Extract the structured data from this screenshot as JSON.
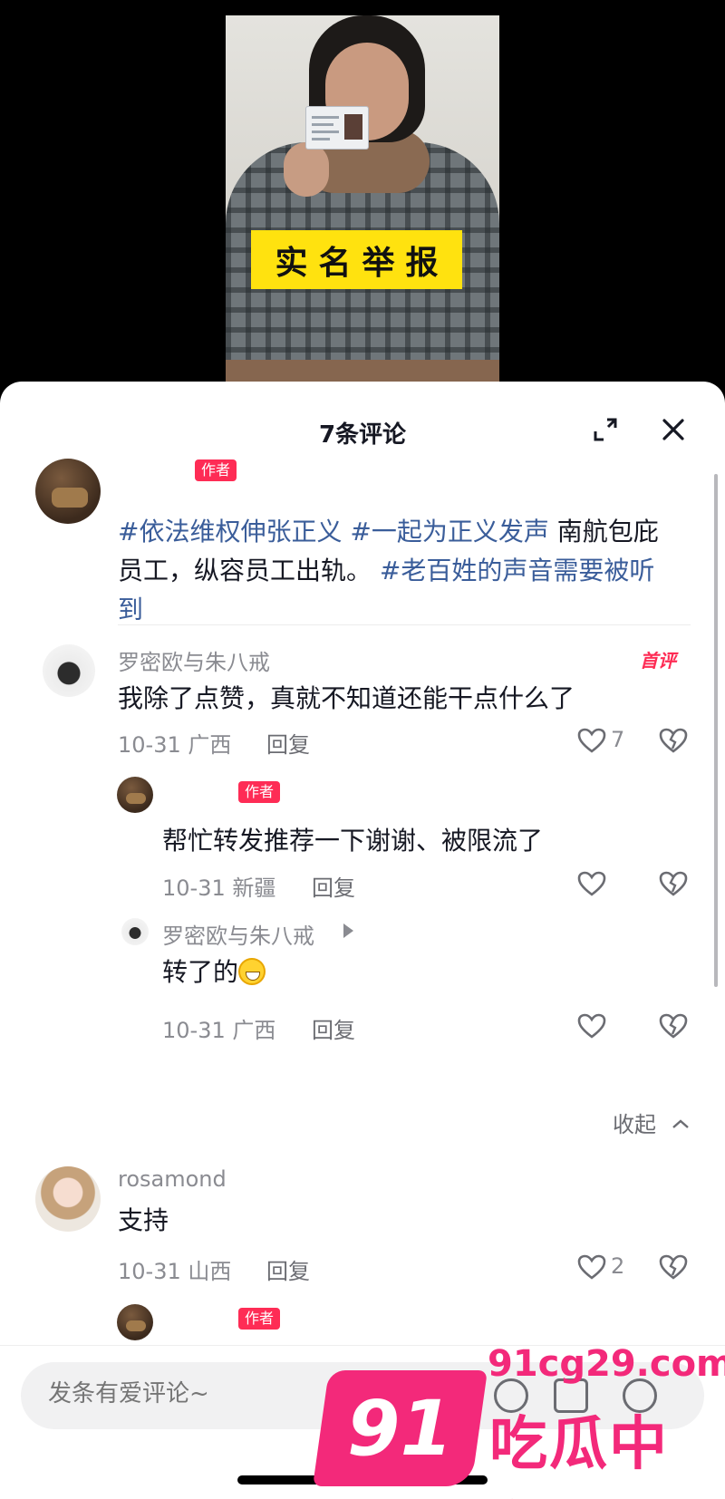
{
  "video": {
    "banner_text": "实名举报"
  },
  "sheet": {
    "title": "7条评论"
  },
  "post": {
    "author_tag": "作者",
    "segments": [
      {
        "text": "#依法维权伸张正义",
        "type": "hashtag"
      },
      {
        "text": " ",
        "type": "plain"
      },
      {
        "text": "#一起为正义发声",
        "type": "hashtag"
      },
      {
        "text": " 南航包庇员工，纵容员工出轨。 ",
        "type": "plain"
      },
      {
        "text": "#老百姓的声音需要被听到",
        "type": "hashtag"
      }
    ]
  },
  "comments": [
    {
      "username": "罗密欧与朱八戒",
      "badge": "首评",
      "text": "我除了点赞，真就不知道还能干点什么了",
      "date_location": "10-31 广西",
      "reply_label": "回复",
      "likes": "7",
      "replies": [
        {
          "author_tag": "作者",
          "text": "帮忙转发推荐一下谢谢、被限流了",
          "date_location": "10-31 新疆",
          "reply_label": "回复"
        },
        {
          "username": "罗密欧与朱八戒",
          "text": "转了的",
          "date_location": "10-31 广西",
          "reply_label": "回复"
        }
      ],
      "collapse_label": "收起"
    },
    {
      "username": "rosamond",
      "text": "支持",
      "date_location": "10-31 山西",
      "reply_label": "回复",
      "likes": "2"
    },
    {
      "author_tag": "作者"
    }
  ],
  "input": {
    "placeholder": "发条有爱评论~"
  },
  "watermark": {
    "number": "91",
    "url": "91cg29.com",
    "name": "吃瓜中心"
  },
  "colors": {
    "accent": "#fe2c55",
    "hashtag": "#3a5d9a",
    "banner": "#ffe20f",
    "watermark": "#f3297a"
  },
  "icons": [
    "expand-icon",
    "close-icon",
    "heart-icon",
    "broken-heart-icon",
    "at-icon",
    "image-icon",
    "emoji-icon",
    "chevron-up-icon",
    "play-triangle-icon"
  ]
}
